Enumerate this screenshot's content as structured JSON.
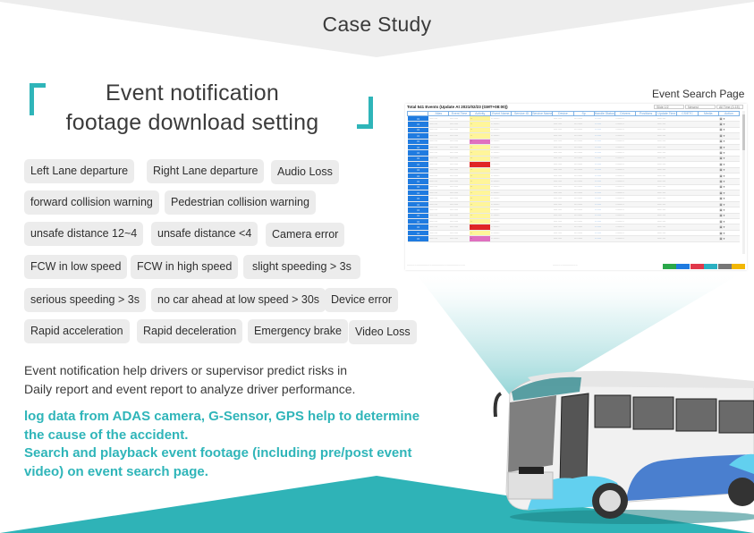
{
  "header": {
    "title": "Case Study"
  },
  "section": {
    "title_line1": "Event notification",
    "title_line2": "footage download setting"
  },
  "tags": [
    "Left Lane departure",
    "Right Lane departure",
    "Audio Loss",
    "forward collision warning",
    "Pedestrian collision warning",
    "unsafe distance 12~4",
    "unsafe distance <4",
    "Camera error",
    "FCW in low speed",
    "FCW in high speed",
    "slight speeding > 3s",
    "serious speeding > 3s",
    "no car ahead at low speed > 30s",
    "Device error",
    "Rapid acceleration",
    "Rapid deceleration",
    "Emergency brake",
    "Video Loss"
  ],
  "description": {
    "line1": "Event notification help drivers or supervisor predict risks in",
    "line2": "Daily report and event report to analyze driver performance."
  },
  "highlights": {
    "line1": "log data from ADAS camera, G-Sensor, GPS help to determine",
    "line2": "the cause of the accident.",
    "line3": "Search and playback event footage (including pre/post event",
    "line4": "video) on event search page."
  },
  "screenshot": {
    "label": "Event Search Page",
    "title": "Total 541 Events (Update At 2021/02/23 (GMT+08:00))",
    "filters": [
      "Slide 1/2",
      "Newest",
      "All Time (0-15)"
    ],
    "columns": [
      "",
      "Alias",
      "Event Time",
      "Activity",
      "Event Name",
      "Service ID",
      "Service Name",
      "Device",
      "Sp",
      "Handle Status",
      "Drivers",
      "Positions",
      "Update Time",
      "CS/ETC",
      "Media",
      "Action"
    ],
    "rows": [
      {
        "activity_color": "yellow"
      },
      {
        "activity_color": "yellow"
      },
      {
        "activity_color": "yellow"
      },
      {
        "activity_color": "yellow"
      },
      {
        "activity_color": "pink"
      },
      {
        "activity_color": "yellow"
      },
      {
        "activity_color": "yellow"
      },
      {
        "activity_color": "yellow"
      },
      {
        "activity_color": "red"
      },
      {
        "activity_color": "yellow"
      },
      {
        "activity_color": "yellow"
      },
      {
        "activity_color": "yellow"
      },
      {
        "activity_color": "yellow"
      },
      {
        "activity_color": "yellow"
      },
      {
        "activity_color": "yellow"
      },
      {
        "activity_color": "yellow"
      },
      {
        "activity_color": "yellow"
      },
      {
        "activity_color": "yellow"
      },
      {
        "activity_color": "yellow"
      },
      {
        "activity_color": "red"
      },
      {
        "activity_color": "yellow"
      },
      {
        "activity_color": "pink"
      }
    ],
    "footer_buttons": [
      "green",
      "blue",
      "red",
      "teal",
      "gray",
      "yellow"
    ]
  },
  "colors": {
    "accent": "#2fb5b9",
    "header_bg": "#ededed",
    "chip_bg": "#ececec",
    "table_button": "#1f7be0"
  }
}
